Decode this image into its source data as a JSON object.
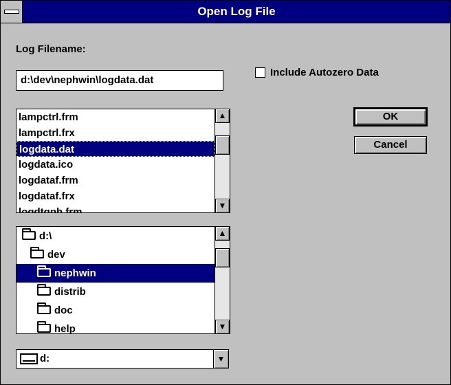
{
  "window": {
    "title": "Open Log File",
    "system_menu_icon": "minus-bar-icon"
  },
  "log_filename": {
    "label": "Log Filename:",
    "value": "d:\\dev\\nephwin\\logdata.dat"
  },
  "autozero": {
    "label": "Include Autozero Data",
    "checked": false
  },
  "file_list": {
    "items": [
      "lampctrl.frm",
      "lampctrl.frx",
      "logdata.dat",
      "logdata.ico",
      "logdataf.frm",
      "logdataf.frx",
      "logdtgph.frm"
    ],
    "selected_index": 2
  },
  "directory_list": {
    "items": [
      {
        "name": "d:\\",
        "icon": "open-folder-icon"
      },
      {
        "name": "dev",
        "icon": "open-folder-icon"
      },
      {
        "name": "nephwin",
        "icon": "open-folder-icon"
      },
      {
        "name": "distrib",
        "icon": "closed-folder-icon"
      },
      {
        "name": "doc",
        "icon": "closed-folder-icon"
      },
      {
        "name": "help",
        "icon": "closed-folder-icon"
      }
    ],
    "selected_index": 2
  },
  "drive": {
    "value": "d:",
    "icon": "drive-icon"
  },
  "buttons": {
    "ok": "OK",
    "cancel": "Cancel"
  },
  "colors": {
    "face": "#c0c0c0",
    "titlebar": "#000080",
    "selection": "#000080"
  },
  "glyphs": {
    "up": "▲",
    "down": "▼"
  }
}
